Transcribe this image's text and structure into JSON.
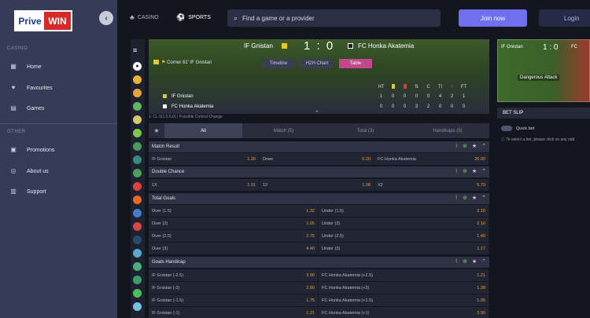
{
  "brand": {
    "left": "Prive",
    "right": "WIN"
  },
  "sidebar": {
    "casino_label": "CASINO",
    "items": [
      {
        "label": "Home",
        "icon": "home-icon",
        "glyph": "▦"
      },
      {
        "label": "Favourites",
        "icon": "heart-icon",
        "glyph": "♥"
      },
      {
        "label": "Games",
        "icon": "cards-icon",
        "glyph": "▤"
      }
    ],
    "other_label": "OTHER",
    "other_items": [
      {
        "label": "Promotions",
        "icon": "gift-icon",
        "glyph": "▣"
      },
      {
        "label": "About us",
        "icon": "info-icon",
        "glyph": "◎"
      },
      {
        "label": "Support",
        "icon": "chat-icon",
        "glyph": "▥"
      }
    ],
    "collapse_glyph": "‹"
  },
  "topbar": {
    "casino": "CASINO",
    "sports": "SPORTS",
    "search_placeholder": "Find a game or a provider",
    "join": "Join now",
    "login": "Login"
  },
  "match": {
    "home": "IF Gnistan",
    "away": "FC Honka Akatemia",
    "score": "1 : 0",
    "event": "Corner 61' IF Gnistan",
    "tabs": [
      "Timeline",
      "H2H Chart",
      "Table"
    ],
    "active_tab": "Table",
    "stats_headers": [
      "HT",
      "",
      "",
      "",
      "C",
      "TI",
      "",
      "FT"
    ],
    "rows": [
      {
        "team": "IF Gnistan",
        "vals": [
          "1",
          "0",
          "0",
          "0",
          "0",
          "4",
          "2",
          "1"
        ]
      },
      {
        "team": "FC Honka Akatemia",
        "vals": [
          "0",
          "0",
          "0",
          "3",
          "2",
          "0",
          "0",
          "0"
        ]
      }
    ],
    "status_line": "1: CL 0(1.5:5.0) | Possible Control Change"
  },
  "market_tabs": [
    "All",
    "Match (5)",
    "Total (3)",
    "Handicaps (5)"
  ],
  "markets": [
    {
      "title": "Match Result",
      "rows": [
        [
          {
            "label": "IF Gnistan",
            "odd": "1.30"
          },
          {
            "label": "Draw",
            "odd": "5.20"
          },
          {
            "label": "FC Honka Akatemia",
            "odd": "26.00"
          }
        ]
      ]
    },
    {
      "title": "Double Chance",
      "rows": [
        [
          {
            "label": "1X",
            "odd": "1.01"
          },
          {
            "label": "12",
            "odd": "1.08"
          },
          {
            "label": "X2",
            "odd": "5.70"
          }
        ]
      ]
    },
    {
      "title": "Total Goals",
      "rows": [
        [
          {
            "label": "Over (1.5)",
            "odd": "1.32"
          },
          {
            "label": "Under (1.5)",
            "odd": "3.10"
          }
        ],
        [
          {
            "label": "Over (2)",
            "odd": "1.65"
          },
          {
            "label": "Under (2)",
            "odd": "2.10"
          }
        ],
        [
          {
            "label": "Over (2.5)",
            "odd": "2.75"
          },
          {
            "label": "Under (2.5)",
            "odd": "1.40"
          }
        ],
        [
          {
            "label": "Over (3)",
            "odd": "4.40"
          },
          {
            "label": "Under (3)",
            "odd": "1.17"
          }
        ]
      ]
    },
    {
      "title": "Goals Handicap",
      "rows": [
        [
          {
            "label": "IF Gnistan (-2.5)",
            "odd": "3.90"
          },
          {
            "label": "FC Honka Akatemia (+2.5)",
            "odd": "1.21"
          }
        ],
        [
          {
            "label": "IF Gnistan (-2)",
            "odd": "2.80"
          },
          {
            "label": "FC Honka Akatemia (+2)",
            "odd": "1.38"
          }
        ],
        [
          {
            "label": "IF Gnistan (-1.5)",
            "odd": "1.75"
          },
          {
            "label": "FC Honka Akatemia (+1.5)",
            "odd": "1.95"
          }
        ],
        [
          {
            "label": "IF Gnistan (-1)",
            "odd": "1.21"
          },
          {
            "label": "FC Honka Akatemia (+1)",
            "odd": "3.90"
          }
        ]
      ]
    }
  ],
  "live": {
    "home": "IF Gnistan",
    "score": "1 : 0",
    "away": "FC",
    "event": "Dangerous Attack"
  },
  "betslip": {
    "title": "BET SLIP",
    "quick_bet": "Quick bet",
    "message": "To select a bet, please click on any odd"
  }
}
